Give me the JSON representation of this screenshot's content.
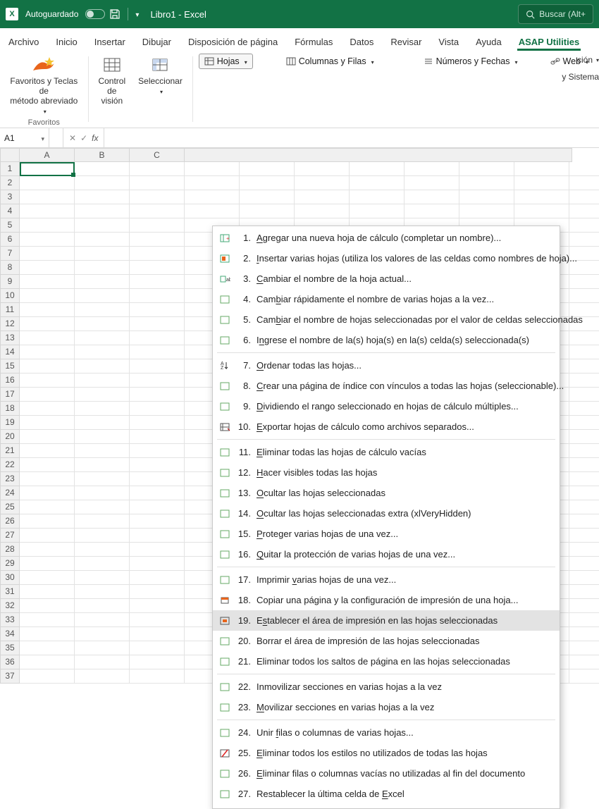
{
  "title_bar": {
    "autosave_label": "Autoguardado",
    "doc_title": "Libro1 - Excel",
    "search_placeholder": "Buscar (Alt+"
  },
  "tabs": {
    "archivo": "Archivo",
    "inicio": "Inicio",
    "insertar": "Insertar",
    "dibujar": "Dibujar",
    "disposicion": "Disposición de página",
    "formulas": "Fórmulas",
    "datos": "Datos",
    "revisar": "Revisar",
    "vista": "Vista",
    "ayuda": "Ayuda",
    "asap": "ASAP Utilities"
  },
  "ribbon": {
    "favoritos_label": "Favoritos y Teclas de\nmétodo abreviado",
    "favoritos_group": "Favoritos",
    "control_vision": "Control\nde visión",
    "seleccionar": "Seleccionar",
    "hojas": "Hojas",
    "columnas_filas": "Columnas y Filas",
    "numeros_fechas": "Números y Fechas",
    "web": "Web",
    "trunc_top": "ción",
    "trunc_bot": "y Sistema"
  },
  "formula_bar": {
    "name_box": "A1"
  },
  "columns": [
    "A",
    "B",
    "C",
    ""
  ],
  "rows": [
    "1",
    "2",
    "3",
    "4",
    "5",
    "6",
    "7",
    "8",
    "9",
    "10",
    "11",
    "12",
    "13",
    "14",
    "15",
    "16",
    "17",
    "18",
    "19",
    "20",
    "21",
    "22",
    "23",
    "24",
    "25",
    "26",
    "27",
    "28",
    "29",
    "30",
    "31",
    "32",
    "33",
    "34",
    "35",
    "36",
    "37"
  ],
  "menu": [
    {
      "n": "1.",
      "t": "Agregar una nueva hoja de cálculo (completar un nombre)...",
      "u": [
        0
      ]
    },
    {
      "n": "2.",
      "t": "Insertar varias hojas (utiliza los valores de las celdas como nombres de hoja)...",
      "u": [
        0
      ]
    },
    {
      "n": "3.",
      "t": "Cambiar el nombre de la hoja actual...",
      "u": [
        0
      ]
    },
    {
      "n": "4.",
      "t": "Cambiar rápidamente el nombre de varias hojas a la vez...",
      "u": [
        3
      ]
    },
    {
      "n": "5.",
      "t": "Cambiar el nombre de hojas seleccionadas por el valor de celdas seleccionadas",
      "u": [
        3
      ]
    },
    {
      "n": "6.",
      "t": "Ingrese el nombre de la(s) hoja(s) en la(s) celda(s) seleccionada(s)",
      "u": [
        1
      ]
    },
    {
      "sep": true
    },
    {
      "n": "7.",
      "t": "Ordenar todas las hojas...",
      "u": [
        0
      ]
    },
    {
      "n": "8.",
      "t": "Crear una página de índice con vínculos a todas las hojas (seleccionable)...",
      "u": [
        0
      ]
    },
    {
      "n": "9.",
      "t": "Dividiendo el rango seleccionado en hojas de cálculo múltiples...",
      "u": [
        0
      ]
    },
    {
      "n": "10.",
      "t": "Exportar hojas de cálculo como archivos separados...",
      "u": [
        0
      ]
    },
    {
      "sep": true
    },
    {
      "n": "11.",
      "t": "Eliminar todas las hojas de cálculo vacías",
      "u": [
        0
      ]
    },
    {
      "n": "12.",
      "t": "Hacer visibles todas las hojas",
      "u": [
        0
      ]
    },
    {
      "n": "13.",
      "t": "Ocultar las hojas seleccionadas",
      "u": [
        0
      ]
    },
    {
      "n": "14.",
      "t": "Ocultar las hojas seleccionadas extra (xlVeryHidden)",
      "u": [
        0
      ]
    },
    {
      "n": "15.",
      "t": "Proteger varias hojas de una vez...",
      "u": [
        0
      ]
    },
    {
      "n": "16.",
      "t": "Quitar la protección de varias hojas de una vez...",
      "u": [
        0
      ]
    },
    {
      "sep": true
    },
    {
      "n": "17.",
      "t": "Imprimir varias hojas de una vez...",
      "u": [
        9
      ]
    },
    {
      "n": "18.",
      "t": "Copiar una página y la configuración de impresión de una hoja...",
      "u": []
    },
    {
      "n": "19.",
      "t": "Establecer el área de impresión en las hojas seleccionadas",
      "u": [
        1
      ],
      "hov": true
    },
    {
      "n": "20.",
      "t": "Borrar el área de impresión de las hojas seleccionadas",
      "u": []
    },
    {
      "n": "21.",
      "t": "Eliminar todos los saltos de página en las hojas seleccionadas",
      "u": []
    },
    {
      "sep": true
    },
    {
      "n": "22.",
      "t": "Inmovilizar secciones en varias hojas a la vez",
      "u": []
    },
    {
      "n": "23.",
      "t": "Movilizar secciones en varias hojas a la vez",
      "u": [
        0
      ]
    },
    {
      "sep": true
    },
    {
      "n": "24.",
      "t": "Unir filas o columnas de varias hojas...",
      "u": [
        5
      ]
    },
    {
      "n": "25.",
      "t": "Eliminar todos los estilos no utilizados de todas las hojas",
      "u": [
        0
      ]
    },
    {
      "n": "26.",
      "t": "Eliminar filas o columnas vacías no utilizadas al fin del documento",
      "u": [
        0
      ]
    },
    {
      "n": "27.",
      "t": "Restablecer la última celda de Excel",
      "u": [
        31
      ]
    }
  ],
  "icons": {
    "menu_fallback": "▦"
  }
}
